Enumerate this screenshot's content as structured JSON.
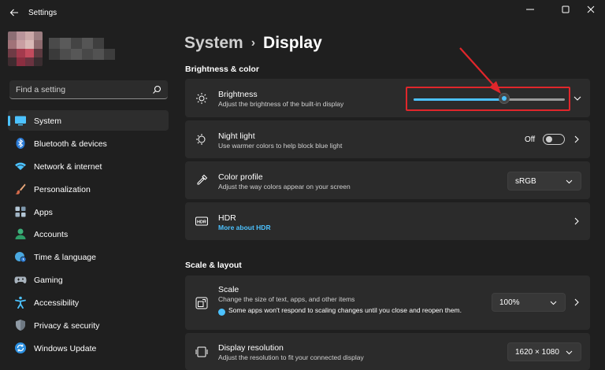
{
  "window": {
    "title": "Settings",
    "controls": [
      "minimize-icon",
      "maximize-icon",
      "close-icon"
    ]
  },
  "sidebar": {
    "search": {
      "placeholder": "Find a setting"
    },
    "items": [
      {
        "label": "System",
        "icon": "display-icon",
        "selected": true
      },
      {
        "label": "Bluetooth & devices",
        "icon": "bluetooth-icon"
      },
      {
        "label": "Network & internet",
        "icon": "wifi-icon"
      },
      {
        "label": "Personalization",
        "icon": "brush-icon"
      },
      {
        "label": "Apps",
        "icon": "apps-icon"
      },
      {
        "label": "Accounts",
        "icon": "person-icon"
      },
      {
        "label": "Time & language",
        "icon": "globe-clock-icon"
      },
      {
        "label": "Gaming",
        "icon": "gamepad-icon"
      },
      {
        "label": "Accessibility",
        "icon": "accessibility-icon"
      },
      {
        "label": "Privacy & security",
        "icon": "shield-icon"
      },
      {
        "label": "Windows Update",
        "icon": "update-icon"
      }
    ]
  },
  "breadcrumb": {
    "parent": "System",
    "separator": "›",
    "current": "Display"
  },
  "sections": {
    "brightness_color": "Brightness & color",
    "scale_layout": "Scale & layout"
  },
  "brightness": {
    "title": "Brightness",
    "subtitle": "Adjust the brightness of the built-in display",
    "level": 0.6
  },
  "night_light": {
    "title": "Night light",
    "subtitle": "Use warmer colors to help block blue light",
    "state": "Off"
  },
  "color_profile": {
    "title": "Color profile",
    "subtitle": "Adjust the way colors appear on your screen",
    "value": "sRGB"
  },
  "hdr": {
    "title": "HDR",
    "link": "More about HDR",
    "icon_text": "HDR"
  },
  "scale": {
    "title": "Scale",
    "subtitle": "Change the size of text, apps, and other items",
    "note": "Some apps won't respond to scaling changes until you close and reopen them.",
    "value": "100%"
  },
  "resolution": {
    "title": "Display resolution",
    "subtitle": "Adjust the resolution to fit your connected display",
    "value": "1620 × 1080"
  },
  "colors": {
    "accent": "#4cc2ff",
    "annotation": "#e0262b",
    "background": "#1f1f1f",
    "card": "#2b2b2b"
  }
}
